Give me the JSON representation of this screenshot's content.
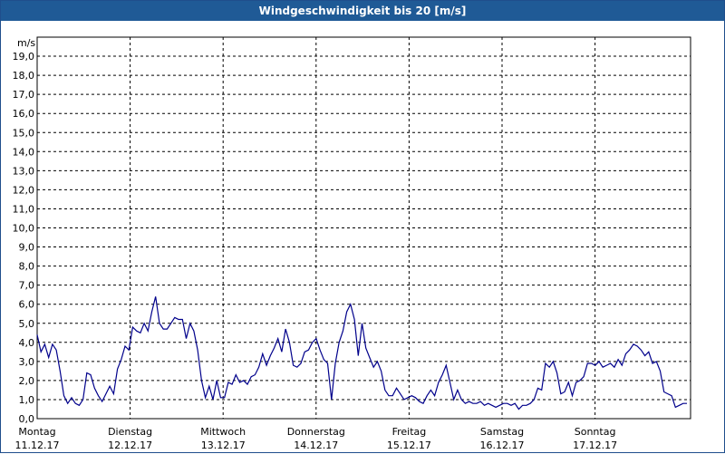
{
  "window": {
    "title": "Windgeschwindigkeit bis 20 [m/s]"
  },
  "chart_data": {
    "type": "line",
    "title": "Windgeschwindigkeit bis 20 [m/s]",
    "ylabel": "m/s",
    "xlabel": "",
    "ylim": [
      0,
      20
    ],
    "yticks": [
      "0,0",
      "1,0",
      "2,0",
      "3,0",
      "4,0",
      "5,0",
      "6,0",
      "7,0",
      "8,0",
      "9,0",
      "10,0",
      "11,0",
      "12,0",
      "13,0",
      "14,0",
      "15,0",
      "16,0",
      "17,0",
      "18,0",
      "19,0"
    ],
    "x_days": [
      {
        "day": "Montag",
        "date": "11.12.17"
      },
      {
        "day": "Dienstag",
        "date": "12.12.17"
      },
      {
        "day": "Mittwoch",
        "date": "13.12.17"
      },
      {
        "day": "Donnerstag",
        "date": "14.12.17"
      },
      {
        "day": "Freitag",
        "date": "15.12.17"
      },
      {
        "day": "Samstag",
        "date": "16.12.17"
      },
      {
        "day": "Sonntag",
        "date": "17.12.17"
      }
    ],
    "grid": true,
    "line_color": "#00008b",
    "series": [
      {
        "values": [
          4.4,
          3.5,
          3.9,
          3.2,
          3.9,
          3.6,
          2.5,
          1.2,
          0.8,
          1.1,
          0.8,
          0.7,
          1.0,
          2.4,
          2.3,
          1.6,
          1.2,
          0.9,
          1.3,
          1.7,
          1.3,
          2.6,
          3.1,
          3.8,
          3.6,
          4.8,
          4.6,
          4.5,
          5.0,
          4.6,
          5.6,
          6.4,
          5.0,
          4.7,
          4.7,
          5.0,
          5.3,
          5.2,
          5.2,
          4.2,
          5.0,
          4.6,
          3.6,
          2.0,
          1.1,
          1.7,
          1.0,
          2.0,
          1.1,
          1.1,
          1.9,
          1.8,
          2.3,
          1.9,
          2.0,
          1.8,
          2.2,
          2.3,
          2.7,
          3.4,
          2.8,
          3.3,
          3.7,
          4.2,
          3.5,
          4.7,
          4.0,
          2.8,
          2.7,
          2.9,
          3.5,
          3.6,
          4.0,
          4.2,
          3.6,
          3.1,
          2.9,
          1.0,
          2.9,
          4.0,
          4.6,
          5.6,
          6.0,
          5.2,
          3.3,
          5.0,
          3.7,
          3.2,
          2.7,
          3.0,
          2.5,
          1.5,
          1.2,
          1.2,
          1.6,
          1.3,
          1.0,
          1.1,
          1.2,
          1.1,
          0.9,
          0.8,
          1.2,
          1.5,
          1.2,
          1.9,
          2.3,
          2.8,
          1.9,
          1.0,
          1.5,
          1.0,
          0.8,
          0.9,
          0.8,
          0.8,
          0.9,
          0.7,
          0.8,
          0.7,
          0.6,
          0.7,
          0.8,
          0.8,
          0.7,
          0.8,
          0.5,
          0.7,
          0.7,
          0.8,
          1.0,
          1.6,
          1.5,
          2.9,
          2.7,
          3.0,
          2.4,
          1.3,
          1.4,
          1.9,
          1.2,
          1.9,
          2.0,
          2.2,
          2.9,
          2.9,
          2.8,
          3.0,
          2.7,
          2.8,
          2.9,
          2.7,
          3.1,
          2.8,
          3.4,
          3.6,
          3.9,
          3.8,
          3.6,
          3.3,
          3.5,
          2.9,
          3.0,
          2.5,
          1.4,
          1.3,
          1.2,
          0.6,
          0.7,
          0.8,
          0.8
        ]
      }
    ]
  }
}
